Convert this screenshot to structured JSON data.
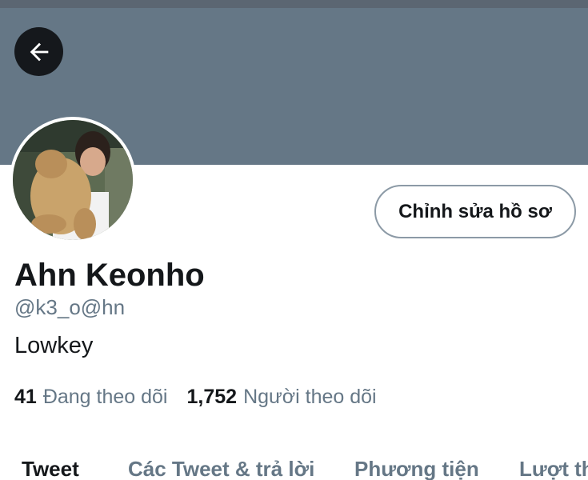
{
  "header": {
    "back_icon": "arrow-left-icon",
    "banner_color": "#657786"
  },
  "profile": {
    "edit_button_label": "Chỉnh sửa hồ sơ",
    "display_name": "Ahn Keonho",
    "handle": "@k3_o@hn",
    "bio": "Lowkey",
    "following_count": "41",
    "following_label": "Đang theo dõi",
    "followers_count": "1,752",
    "followers_label": "Người theo dõi"
  },
  "tabs": [
    {
      "label": "Tweet",
      "active": true
    },
    {
      "label": "Các Tweet & trả lời",
      "active": false
    },
    {
      "label": "Phương tiện",
      "active": false
    },
    {
      "label": "Lượt thích",
      "active": false
    }
  ],
  "colors": {
    "primary_text": "#14171a",
    "secondary_text": "#657786",
    "button_border": "#8c9aa6"
  }
}
